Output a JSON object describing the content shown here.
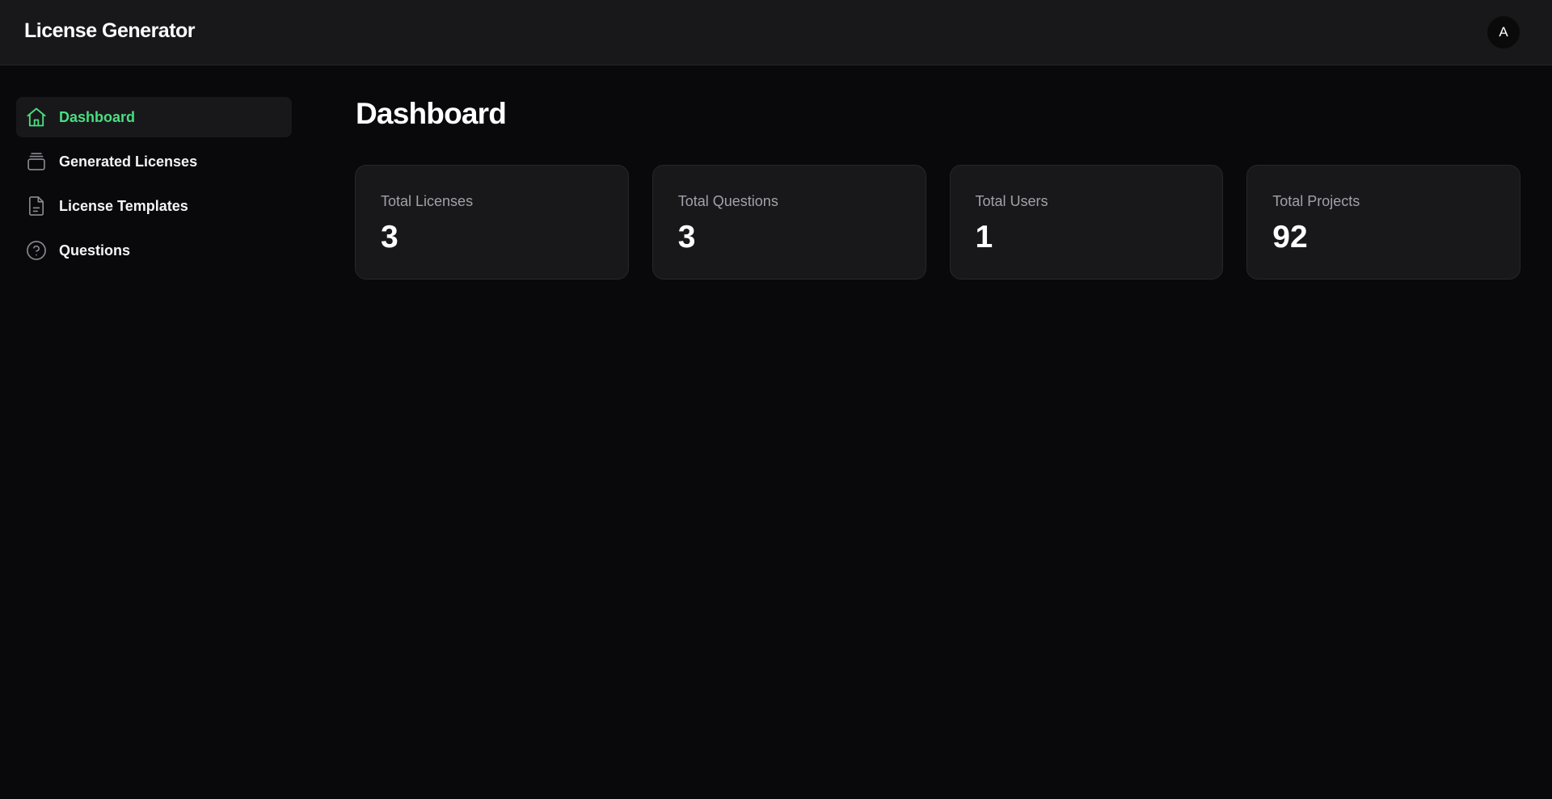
{
  "header": {
    "app_title": "License Generator",
    "avatar_initial": "A"
  },
  "sidebar": {
    "items": [
      {
        "label": "Dashboard",
        "icon": "home-icon",
        "active": true
      },
      {
        "label": "Generated Licenses",
        "icon": "archive-icon",
        "active": false
      },
      {
        "label": "License Templates",
        "icon": "file-text-icon",
        "active": false
      },
      {
        "label": "Questions",
        "icon": "help-circle-icon",
        "active": false
      }
    ]
  },
  "main": {
    "title": "Dashboard",
    "stats": [
      {
        "label": "Total Licenses",
        "value": "3"
      },
      {
        "label": "Total Questions",
        "value": "3"
      },
      {
        "label": "Total Users",
        "value": "1"
      },
      {
        "label": "Total Projects",
        "value": "92"
      }
    ]
  },
  "colors": {
    "background": "#09090b",
    "surface": "#18181b",
    "border": "#27272a",
    "accent": "#4ade80",
    "muted_text": "#a1a1aa"
  }
}
